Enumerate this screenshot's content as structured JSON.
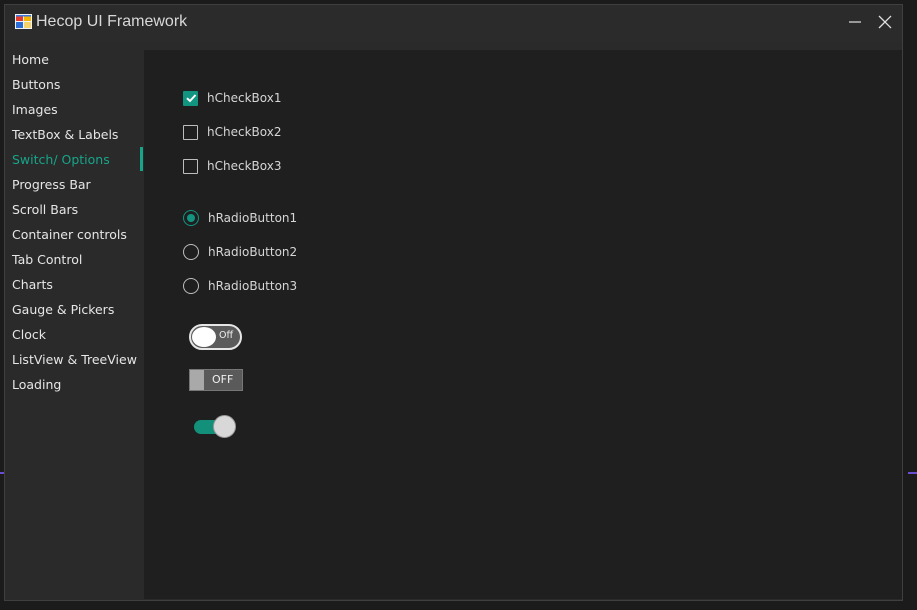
{
  "window": {
    "title": "Hecop UI Framework",
    "icon": "app-window-icon"
  },
  "titlebar_buttons": {
    "minimize": "minimize-icon",
    "close": "close-icon"
  },
  "sidebar": {
    "active_index": 4,
    "items": [
      {
        "label": "Home"
      },
      {
        "label": "Buttons"
      },
      {
        "label": "Images"
      },
      {
        "label": "TextBox & Labels"
      },
      {
        "label": "Switch/ Options"
      },
      {
        "label": "Progress Bar"
      },
      {
        "label": "Scroll Bars"
      },
      {
        "label": "Container controls"
      },
      {
        "label": "Tab Control"
      },
      {
        "label": "Charts"
      },
      {
        "label": "Gauge & Pickers"
      },
      {
        "label": "Clock"
      },
      {
        "label": "ListView & TreeView"
      },
      {
        "label": "Loading"
      }
    ]
  },
  "checkboxes": [
    {
      "label": "hCheckBox1",
      "checked": true
    },
    {
      "label": "hCheckBox2",
      "checked": false
    },
    {
      "label": "hCheckBox3",
      "checked": false
    }
  ],
  "radios": [
    {
      "label": "hRadioButton1",
      "selected": true
    },
    {
      "label": "hRadioButton2",
      "selected": false
    },
    {
      "label": "hRadioButton3",
      "selected": false
    }
  ],
  "toggles": {
    "rounded": {
      "text": "Off",
      "on": false
    },
    "flat": {
      "text": "OFF",
      "on": false
    },
    "material": {
      "on": true
    }
  },
  "colors": {
    "accent": "#129580",
    "background": "#1f1f1f",
    "sidebar": "#2a2a2a"
  }
}
